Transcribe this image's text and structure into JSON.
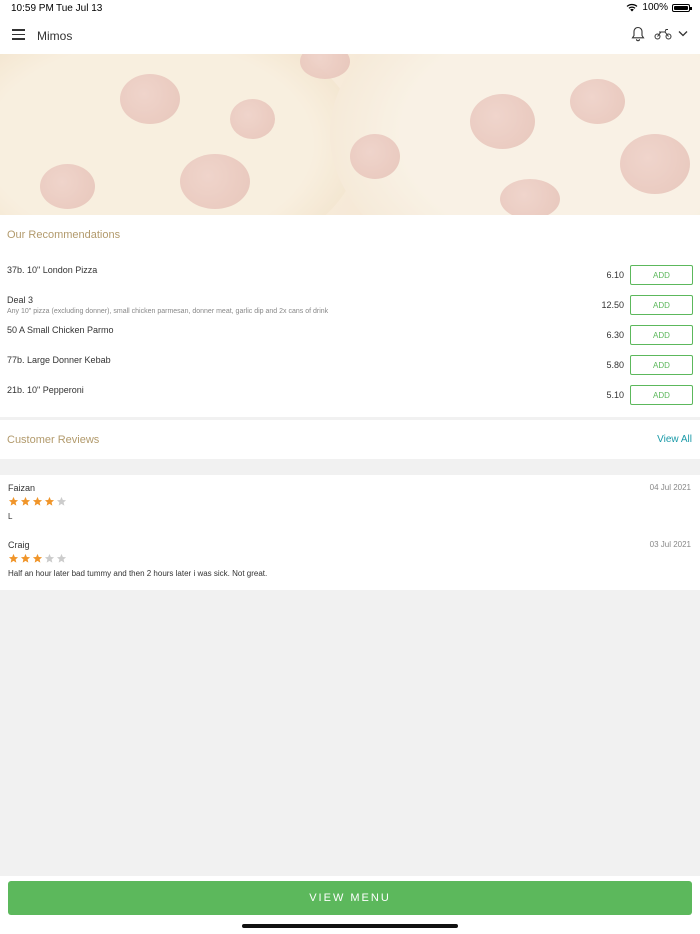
{
  "status_bar": {
    "time": "10:59 PM",
    "date": "Tue Jul 13",
    "battery": "100%"
  },
  "header": {
    "title": "Mimos",
    "icons": {
      "menu": "menu-icon",
      "notifications": "bell-icon",
      "delivery": "scooter-icon",
      "dropdown": "chevron-down-icon"
    }
  },
  "recommendations": {
    "title": "Our Recommendations",
    "add_label": "ADD",
    "items": [
      {
        "name": "37b. 10\" London Pizza",
        "description": "",
        "price": "6.10"
      },
      {
        "name": "Deal 3",
        "description": "Any 10\" pizza (excluding donner), small chicken parmesan, donner meat, garlic dip and 2x cans of drink",
        "price": "12.50"
      },
      {
        "name": "50 A Small Chicken Parmo",
        "description": "",
        "price": "6.30"
      },
      {
        "name": "77b. Large Donner Kebab",
        "description": "",
        "price": "5.80"
      },
      {
        "name": "21b. 10\" Pepperoni",
        "description": "",
        "price": "5.10"
      }
    ]
  },
  "reviews": {
    "title": "Customer Reviews",
    "view_all": "View All",
    "items": [
      {
        "name": "Faizan",
        "date": "04 Jul 2021",
        "rating": 4,
        "text": "L"
      },
      {
        "name": "Craig",
        "date": "03 Jul 2021",
        "rating": 3,
        "text": "Half an hour later bad tummy and then 2 hours later i was sick. Not great."
      }
    ]
  },
  "footer": {
    "view_menu": "VIEW MENU"
  },
  "colors": {
    "accent_green": "#5cb85c",
    "section_title": "#b29a6c",
    "link_teal": "#1a9aa8",
    "star_filled": "#f0952a",
    "star_empty": "#cccccc"
  }
}
